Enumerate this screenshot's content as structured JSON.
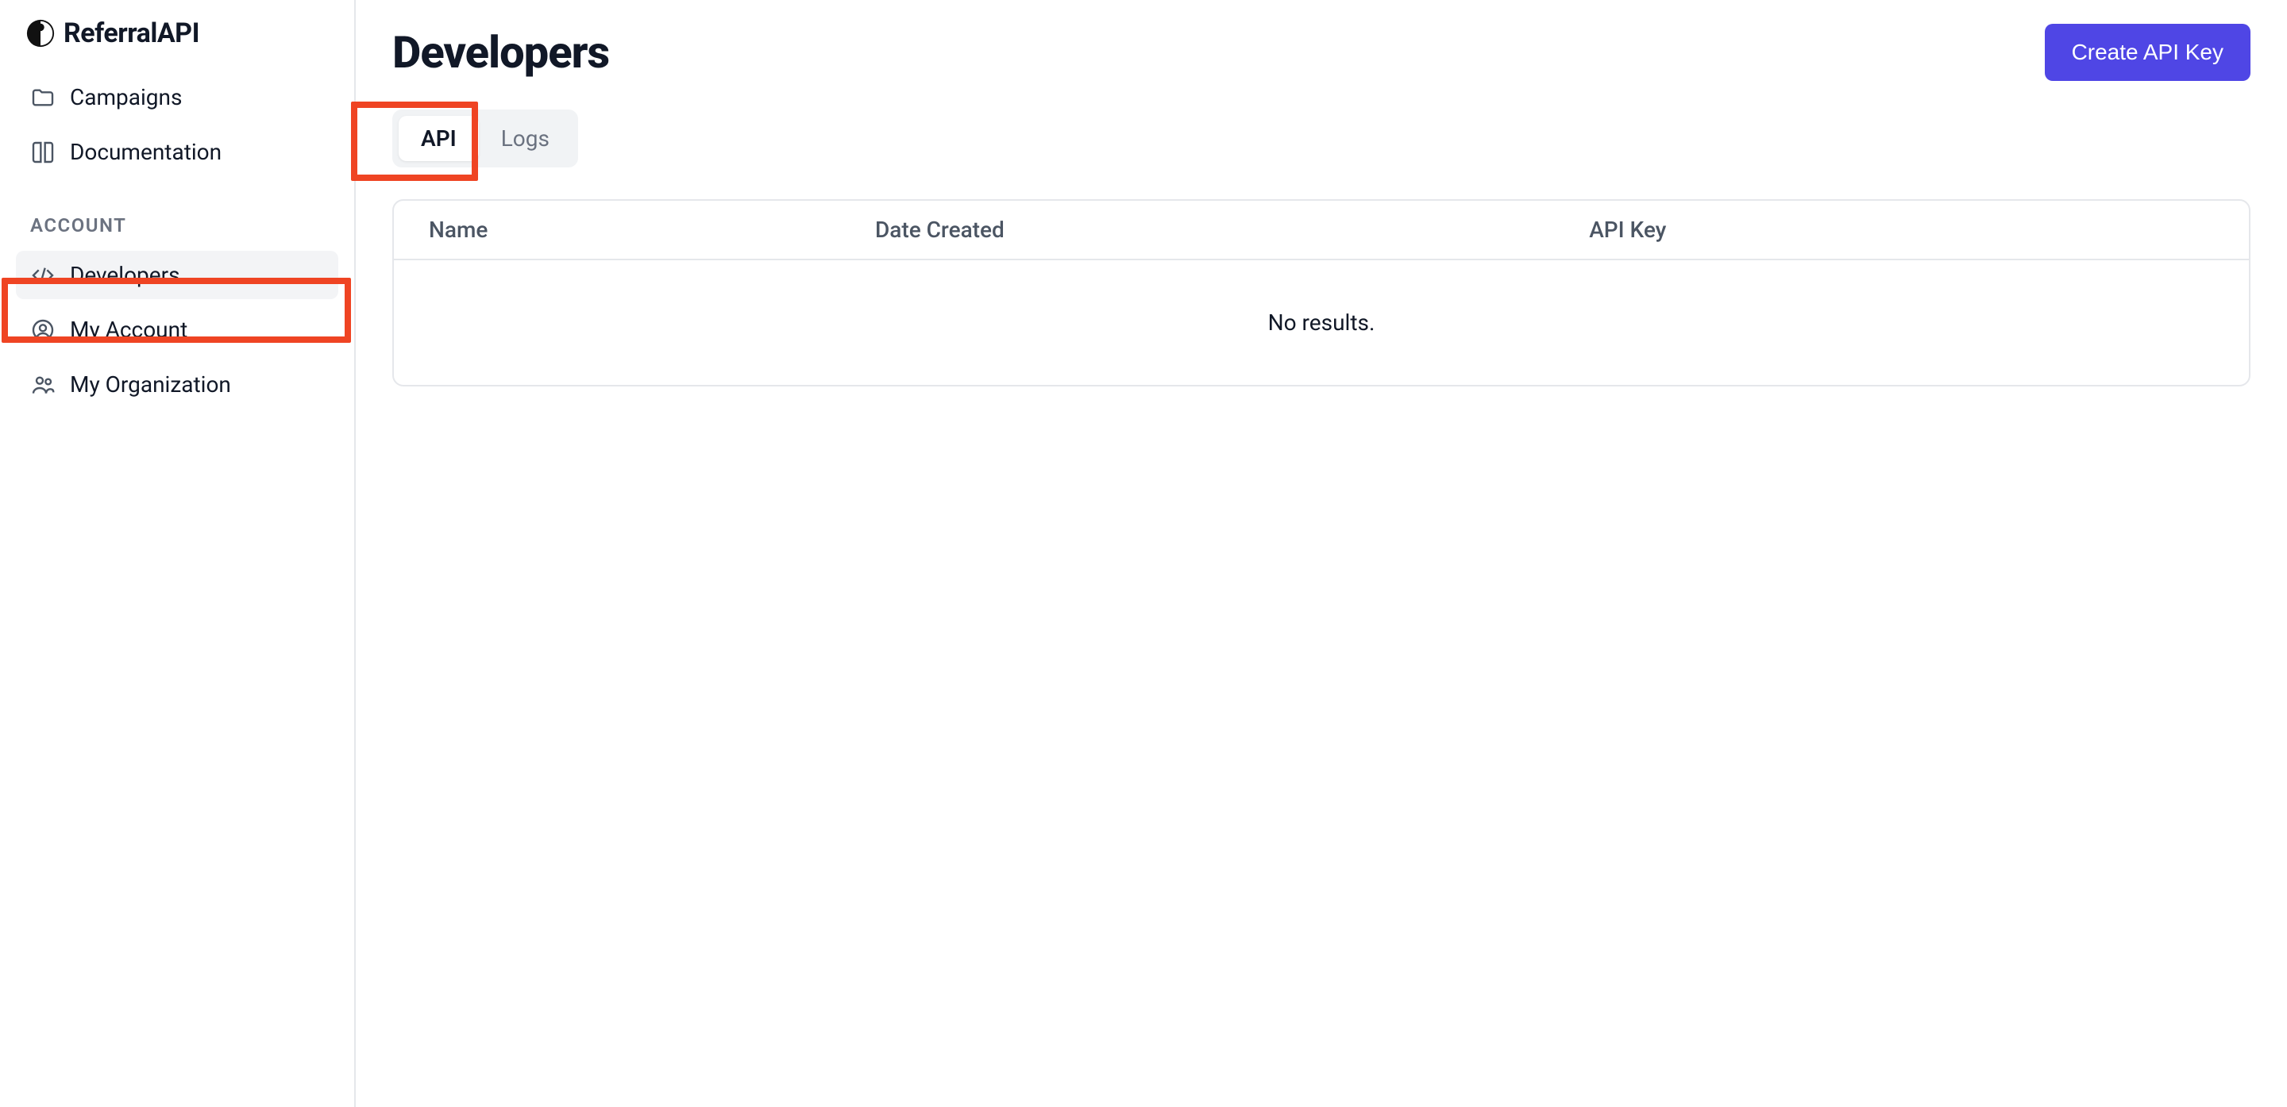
{
  "brand": "ReferralAPI",
  "sidebar": {
    "items": [
      {
        "label": "Campaigns"
      },
      {
        "label": "Documentation"
      }
    ],
    "section_label": "ACCOUNT",
    "account_items": [
      {
        "label": "Developers"
      },
      {
        "label": "My Account"
      },
      {
        "label": "My Organization"
      }
    ]
  },
  "page": {
    "title": "Developers",
    "primary_button": "Create API Key"
  },
  "tabs": [
    {
      "label": "API"
    },
    {
      "label": "Logs"
    }
  ],
  "table": {
    "columns": [
      "Name",
      "Date Created",
      "API Key"
    ],
    "empty_text": "No results."
  }
}
